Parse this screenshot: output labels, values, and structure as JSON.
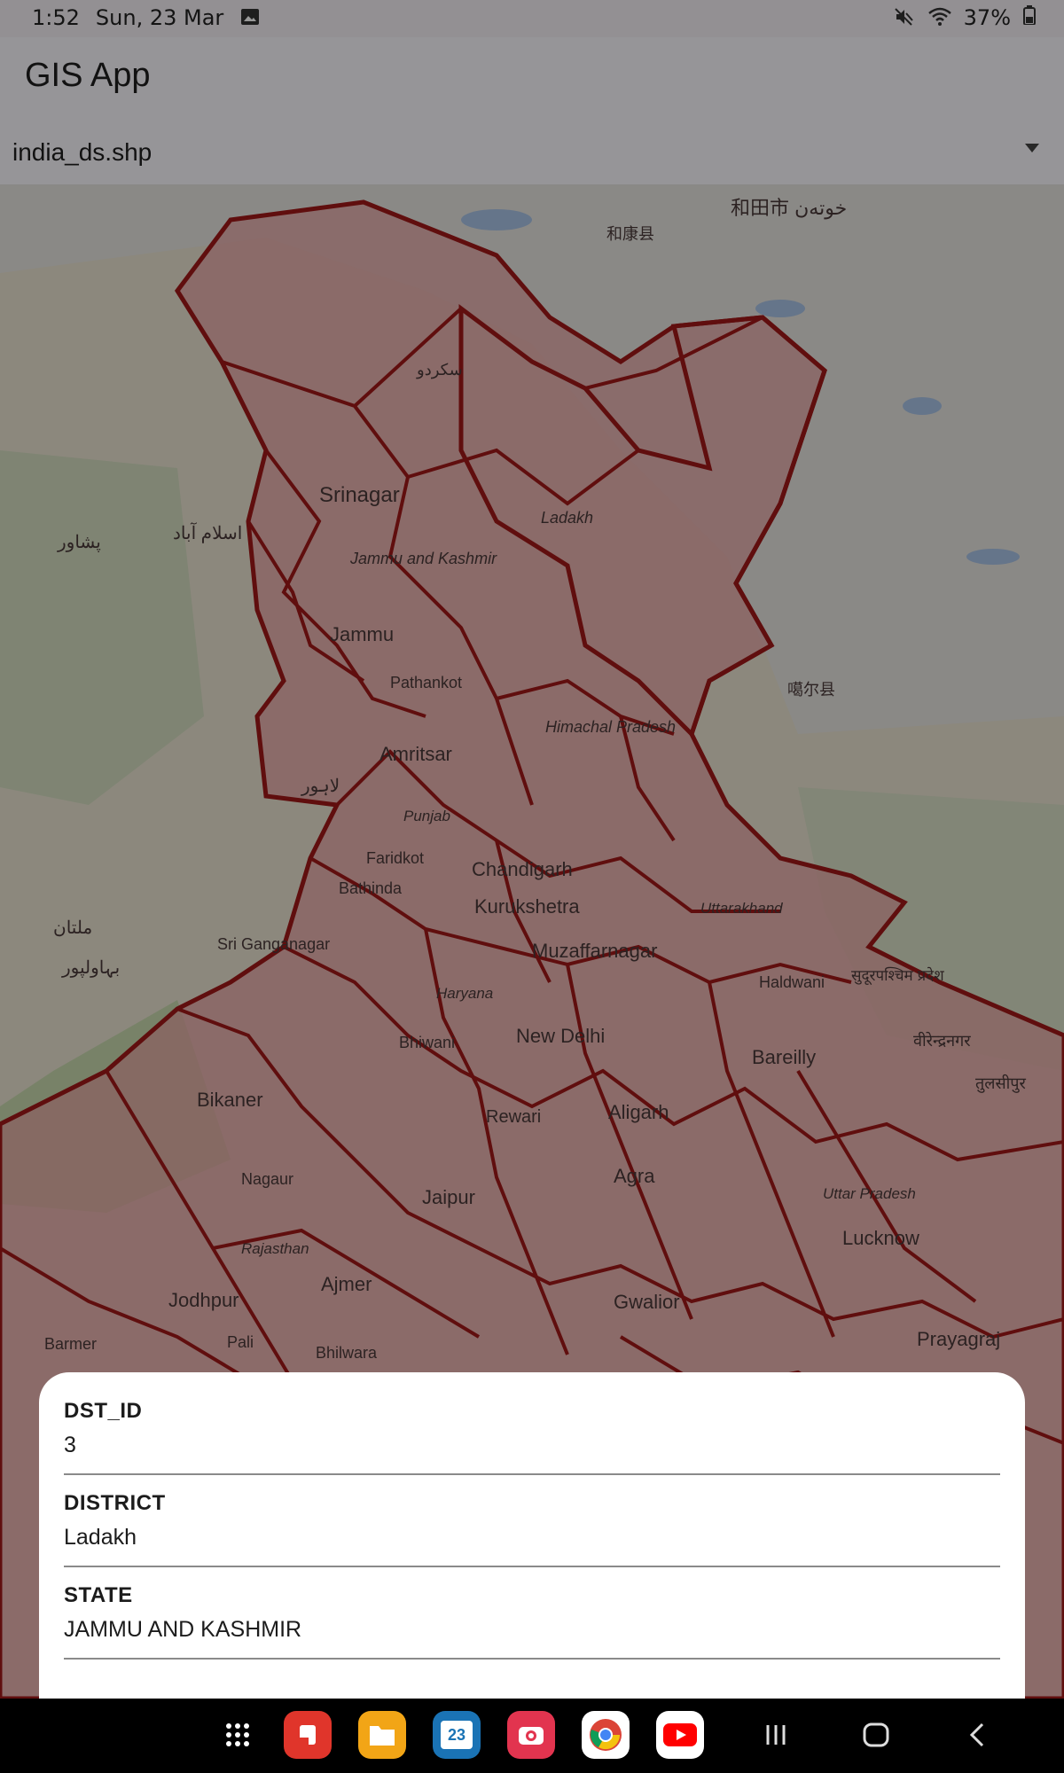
{
  "status": {
    "time": "1:52",
    "date": "Sun, 23 Mar",
    "battery": "37%"
  },
  "app": {
    "title": "GIS App"
  },
  "dropdown": {
    "selected": "india_ds.shp"
  },
  "map": {
    "labels": [
      {
        "id": "skardu",
        "text": "سکردو"
      },
      {
        "id": "srinagar",
        "text": "Srinagar"
      },
      {
        "id": "ladakh",
        "text": "Ladakh"
      },
      {
        "id": "jammu-kashmir",
        "text": "Jammu and Kashmir"
      },
      {
        "id": "jammu",
        "text": "Jammu"
      },
      {
        "id": "pathankot",
        "text": "Pathankot"
      },
      {
        "id": "himachal",
        "text": "Himachal Pradesh"
      },
      {
        "id": "amritsar",
        "text": "Amritsar"
      },
      {
        "id": "punjab",
        "text": "Punjab"
      },
      {
        "id": "chandigarh",
        "text": "Chandigarh"
      },
      {
        "id": "faridkot",
        "text": "Faridkot"
      },
      {
        "id": "bathinda",
        "text": "Bathinda"
      },
      {
        "id": "kurukshetra",
        "text": "Kurukshetra"
      },
      {
        "id": "uttarakhand",
        "text": "Uttarakhand"
      },
      {
        "id": "muzaffarnagar",
        "text": "Muzaffarnagar"
      },
      {
        "id": "sri-ganganagar",
        "text": "Sri Ganganagar"
      },
      {
        "id": "haryana",
        "text": "Haryana"
      },
      {
        "id": "haldwani",
        "text": "Haldwani"
      },
      {
        "id": "new-delhi",
        "text": "New Delhi"
      },
      {
        "id": "bareilly",
        "text": "Bareilly"
      },
      {
        "id": "bhiwani",
        "text": "Bhiwani"
      },
      {
        "id": "bikaner",
        "text": "Bikaner"
      },
      {
        "id": "aligarh",
        "text": "Aligarh"
      },
      {
        "id": "rewari",
        "text": "Rewari"
      },
      {
        "id": "nagaur",
        "text": "Nagaur"
      },
      {
        "id": "jaipur",
        "text": "Jaipur"
      },
      {
        "id": "agra",
        "text": "Agra"
      },
      {
        "id": "uttar-pradesh",
        "text": "Uttar Pradesh"
      },
      {
        "id": "lucknow",
        "text": "Lucknow"
      },
      {
        "id": "rajasthan",
        "text": "Rajasthan"
      },
      {
        "id": "ajmer",
        "text": "Ajmer"
      },
      {
        "id": "gwalior",
        "text": "Gwalior"
      },
      {
        "id": "jodhpur",
        "text": "Jodhpur"
      },
      {
        "id": "barmer",
        "text": "Barmer"
      },
      {
        "id": "pali",
        "text": "Pali"
      },
      {
        "id": "bhilwara",
        "text": "Bhilwara"
      },
      {
        "id": "prayagraj",
        "text": "Prayagraj"
      },
      {
        "id": "multan",
        "text": "ملتان"
      },
      {
        "id": "islamabad",
        "text": "اسلام آباد"
      },
      {
        "id": "peshawar",
        "text": "پشاور"
      },
      {
        "id": "lahore",
        "text": "لاہور"
      },
      {
        "id": "hotan",
        "text": "和田市 خوتەن"
      },
      {
        "id": "hekang",
        "text": "和康县"
      },
      {
        "id": "gar",
        "text": "噶尔县"
      },
      {
        "id": "tulsipur",
        "text": "तुलसीपुर"
      },
      {
        "id": "birendranagar",
        "text": "वीरेन्द्रनगर"
      },
      {
        "id": "sudurpaschim",
        "text": "सुदूरपश्चिम प्रदेश"
      },
      {
        "id": "bahawalpur",
        "text": "بہاولپور"
      }
    ]
  },
  "details": [
    {
      "key": "DST_ID",
      "value": "3"
    },
    {
      "key": "DISTRICT",
      "value": "Ladakh"
    },
    {
      "key": "STATE",
      "value": "JAMMU AND KASHMIR"
    }
  ],
  "nav": {
    "calendar_day": "23"
  }
}
